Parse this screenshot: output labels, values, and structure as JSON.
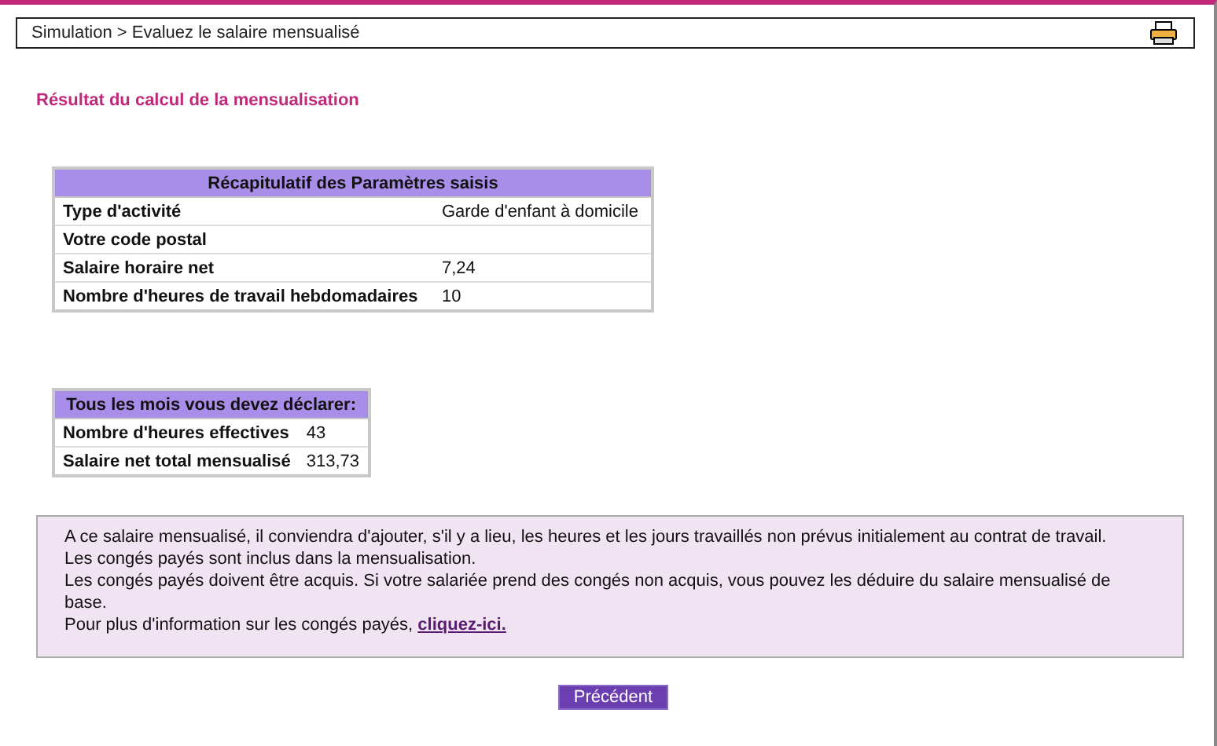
{
  "breadcrumb": "Simulation > Evaluez le salaire mensualisé",
  "title": "Résultat du calcul de la mensualisation",
  "params": {
    "heading": "Récapitulatif des Paramètres saisis",
    "rows": [
      {
        "label": "Type d'activité",
        "value": "Garde d'enfant à domicile"
      },
      {
        "label": "Votre code postal"
      },
      {
        "label": "Salaire horaire net",
        "value": "7,24"
      },
      {
        "label": "Nombre d'heures de travail hebdomadaires",
        "value": "10"
      }
    ]
  },
  "monthly": {
    "heading": "Tous les mois vous devez déclarer:",
    "rows": [
      {
        "label": "Nombre d'heures effectives",
        "value": "43"
      },
      {
        "label": "Salaire net total mensualisé",
        "value": "313,73"
      }
    ]
  },
  "notes": [
    {
      "text": "A ce salaire mensualisé, il conviendra d'ajouter, s'il y a lieu, les heures et les jours travaillés non prévus initialement au contrat de travail."
    },
    {
      "text": "Les congés payés sont inclus dans la mensualisation."
    },
    {
      "text": "Les congés payés doivent être acquis. Si votre salariée prend des congés non acquis, vous pouvez les déduire du salaire mensualisé de base."
    },
    {
      "text": "Pour plus d'information sur les congés payés, ",
      "link": "cliquez-ici."
    }
  ],
  "button": "Précédent"
}
